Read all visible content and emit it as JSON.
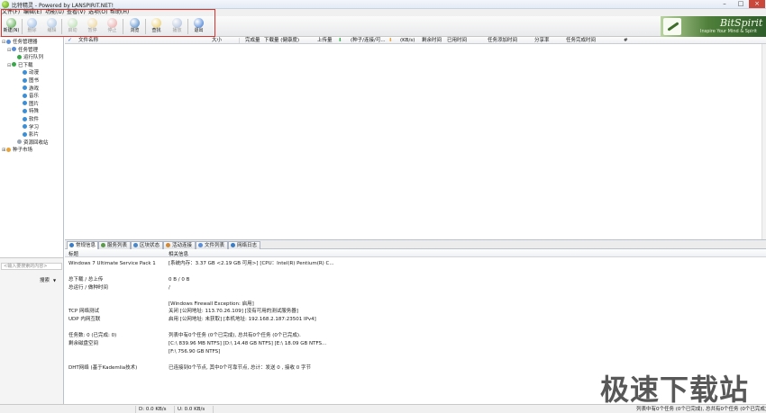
{
  "window": {
    "title": "比特精灵 - Powered by LANSPIRIT.NET!"
  },
  "menu": [
    "文件(F)",
    "编辑(E)",
    "功能(U)",
    "查看(V)",
    "选项(O)",
    "帮助(H)"
  ],
  "toolbar": [
    {
      "label": "新建(N)",
      "icon": "new-task-icon",
      "color": "#46a03a",
      "disabled": false
    },
    {
      "label": "删除",
      "icon": "delete-icon",
      "color": "#3d7fd6",
      "disabled": true
    },
    {
      "label": "编辑",
      "icon": "edit-icon",
      "color": "#5a8fd0",
      "disabled": true
    },
    {
      "label": "启动",
      "icon": "start-icon",
      "color": "#7ec86a",
      "disabled": true
    },
    {
      "label": "暂停",
      "icon": "pause-icon",
      "color": "#e8b63a",
      "disabled": true
    },
    {
      "label": "停止",
      "icon": "stop-icon",
      "color": "#e0605a",
      "disabled": true
    },
    {
      "label": "浏览",
      "icon": "browse-icon",
      "color": "#3b7cc4",
      "disabled": false
    },
    {
      "label": "查找",
      "icon": "find-icon",
      "color": "#e7c85a",
      "disabled": false
    },
    {
      "label": "播放",
      "icon": "play-icon",
      "color": "#6a8cc4",
      "disabled": true
    },
    {
      "label": "退出",
      "icon": "exit-icon",
      "color": "#2c6ed0",
      "disabled": false
    }
  ],
  "brand": {
    "name": "BitSpirit",
    "slogan": "Inspire Your Mind & Spirit"
  },
  "sidebar": {
    "tree": [
      {
        "label": "任务管理器",
        "toggle": "⊟",
        "icon": "task-manager-icon",
        "color": "#5b8ed6"
      },
      {
        "label": "任务管理",
        "toggle": "⊟",
        "icon": "task-folder-icon",
        "color": "#5b8ed6"
      },
      {
        "label": "运行队列",
        "toggle": "",
        "icon": "running-queue-icon",
        "color": "#3aa84a"
      },
      {
        "label": "已下载",
        "toggle": "⊟",
        "icon": "downloaded-icon",
        "color": "#3aa84a"
      },
      {
        "label": "动漫",
        "toggle": "",
        "icon": "category-icon",
        "color": "#3b8fd6"
      },
      {
        "label": "图书",
        "toggle": "",
        "icon": "category-icon",
        "color": "#3b8fd6"
      },
      {
        "label": "游戏",
        "toggle": "",
        "icon": "category-icon",
        "color": "#3b8fd6"
      },
      {
        "label": "音乐",
        "toggle": "",
        "icon": "category-icon",
        "color": "#3b8fd6"
      },
      {
        "label": "图片",
        "toggle": "",
        "icon": "category-icon",
        "color": "#3b8fd6"
      },
      {
        "label": "特殊",
        "toggle": "",
        "icon": "category-icon",
        "color": "#3b8fd6"
      },
      {
        "label": "软件",
        "toggle": "",
        "icon": "category-icon",
        "color": "#3b8fd6"
      },
      {
        "label": "学习",
        "toggle": "",
        "icon": "category-icon",
        "color": "#3b8fd6"
      },
      {
        "label": "影片",
        "toggle": "",
        "icon": "category-icon",
        "color": "#3b8fd6"
      },
      {
        "label": "资源回收站",
        "toggle": "",
        "icon": "recycle-bin-icon",
        "color": "#9aa6b3"
      },
      {
        "label": "种子市场",
        "toggle": "⊞",
        "icon": "torrent-market-icon",
        "color": "#e8a33a"
      }
    ],
    "search_placeholder": "<输入要搜索的内容>",
    "search_button": "搜索"
  },
  "table": {
    "columns": [
      "文件名称",
      "大小",
      "完成量",
      "下载量 (健康度)",
      "上传量",
      "(种子/连接/可...",
      "(KB/s)",
      "剩余时间",
      "已用时间",
      "任务添加时间",
      "分享率",
      "任务完成时间",
      "#"
    ]
  },
  "tabs": [
    {
      "label": "常规信息",
      "icon": "info-tab-icon",
      "color": "#3b7cc4",
      "active": true
    },
    {
      "label": "服务列表",
      "icon": "server-list-icon",
      "color": "#5b9a4a",
      "active": false
    },
    {
      "label": "区块状态",
      "icon": "block-status-icon",
      "color": "#4a86c8",
      "active": false
    },
    {
      "label": "活动连接",
      "icon": "connections-icon",
      "color": "#d08a3a",
      "active": false
    },
    {
      "label": "文件列表",
      "icon": "file-list-icon",
      "color": "#5b8ed6",
      "active": false
    },
    {
      "label": "网络日志",
      "icon": "network-log-icon",
      "color": "#3b7cc4",
      "active": false
    }
  ],
  "info": {
    "headers": [
      "标题",
      "相关信息"
    ],
    "rows": [
      {
        "label": "Windows 7 Ultimate Service Pack 1",
        "value": "[系统内存：3.37 GB <2.19 GB 可用>] [CPU：Intel(R) Pentium(R) C..."
      },
      {
        "label": "",
        "value": ""
      },
      {
        "label": "总下载 / 总上传",
        "value": "0 B / 0 B"
      },
      {
        "label": "总运行 / 做种时间",
        "value": "/"
      },
      {
        "label": "",
        "value": ""
      },
      {
        "label": "",
        "value": "[Windows Firewall Exception: 启用]"
      },
      {
        "label": "TCP 网络测试",
        "value": "关闭 [公网地址: 113.70.26.109] [没有可用的测试服务器]"
      },
      {
        "label": "UDP 内网互联",
        "value": "启用 [公网地址: 未获取] [本机地址: 192.168.2.187:23501 IPv4]"
      },
      {
        "label": "",
        "value": ""
      },
      {
        "label": "任务数: 0 (已完成: 0)",
        "value": "列表中有0个任务 (0个已完成), 总共有0个任务 (0个已完成)."
      },
      {
        "label": "剩余磁盘空间",
        "value": "[C:\\ 839.96 MB  NTFS]  [D:\\ 14.48 GB  NTFS]  [E:\\ 18.09 GB  NTFS..."
      },
      {
        "label": "",
        "value": "[F:\\ 756.90 GB  NTFS]"
      },
      {
        "label": "",
        "value": ""
      },
      {
        "label": "DHT网络 (基于Kademlia技术)",
        "value": "已连接到0个节点, 其中0个可靠节点, 总计：发送 0 , 接收 0 字节"
      }
    ]
  },
  "status": {
    "download": "D: 0.0 KB/s",
    "upload": "U: 0.0 KB/s",
    "tasks": "列表中有0个任务 (0个已完成), 总共有0个任务 (0个已完成)"
  },
  "watermark": "极速下载站"
}
